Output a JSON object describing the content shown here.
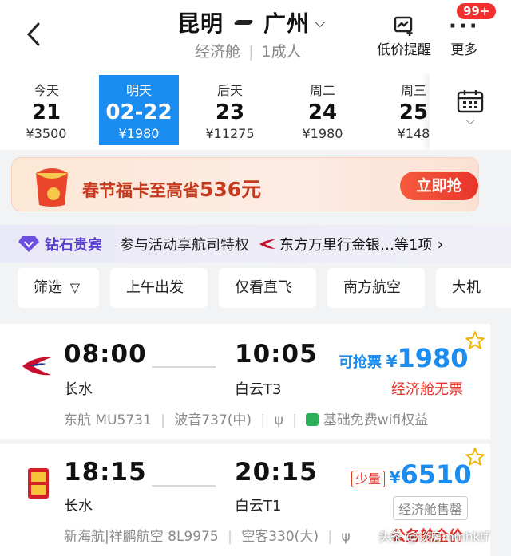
{
  "header": {
    "origin": "昆明",
    "destination": "广州",
    "cabin": "经济舱",
    "passengers": "1成人",
    "price_alert": "低价提醒",
    "more": "更多",
    "badge": "99+"
  },
  "dates": [
    {
      "label": "今天",
      "day": "21",
      "price": "¥3500"
    },
    {
      "label": "明天",
      "day": "02-22",
      "price": "¥1980",
      "active": true
    },
    {
      "label": "后天",
      "day": "23",
      "price": "¥11275"
    },
    {
      "label": "周二",
      "day": "24",
      "price": "¥1980"
    },
    {
      "label": "周三",
      "day": "25",
      "price": "¥148"
    }
  ],
  "promo": {
    "text": "春节福卡至高省",
    "amount": "536元",
    "button": "立即抢"
  },
  "vip": {
    "title": "钻石贵宾",
    "desc": "参与活动享航司特权",
    "airline": "东方万里行金银…等1项"
  },
  "filters": [
    "筛选",
    "上午出发",
    "仅看直飞",
    "南方航空",
    "大机"
  ],
  "flights": [
    {
      "dep_time": "08:00",
      "dep_airport": "长水",
      "arr_time": "10:05",
      "arr_airport": "白云T3",
      "tag": "可抢票",
      "currency": "¥",
      "price": "1980",
      "status": "经济舱无票",
      "airline": "东航 MU5731",
      "aircraft": "波音737(中)",
      "wifi": "基础免费wifi权益"
    },
    {
      "dep_time": "18:15",
      "dep_airport": "长水",
      "arr_time": "20:15",
      "arr_airport": "白云T1",
      "tag": "少量",
      "currency": "¥",
      "price": "6510",
      "status": "经济舱售罄",
      "airline": "新海航|祥鹏航空 8L9975",
      "aircraft": "空客330(大)",
      "extra": "公务舱全价"
    }
  ],
  "watermark": "头条 @谈房mmhktf",
  "colors": {
    "accent": "#1b8cf0",
    "red": "#e8342a",
    "vip": "#5a3fcf"
  }
}
